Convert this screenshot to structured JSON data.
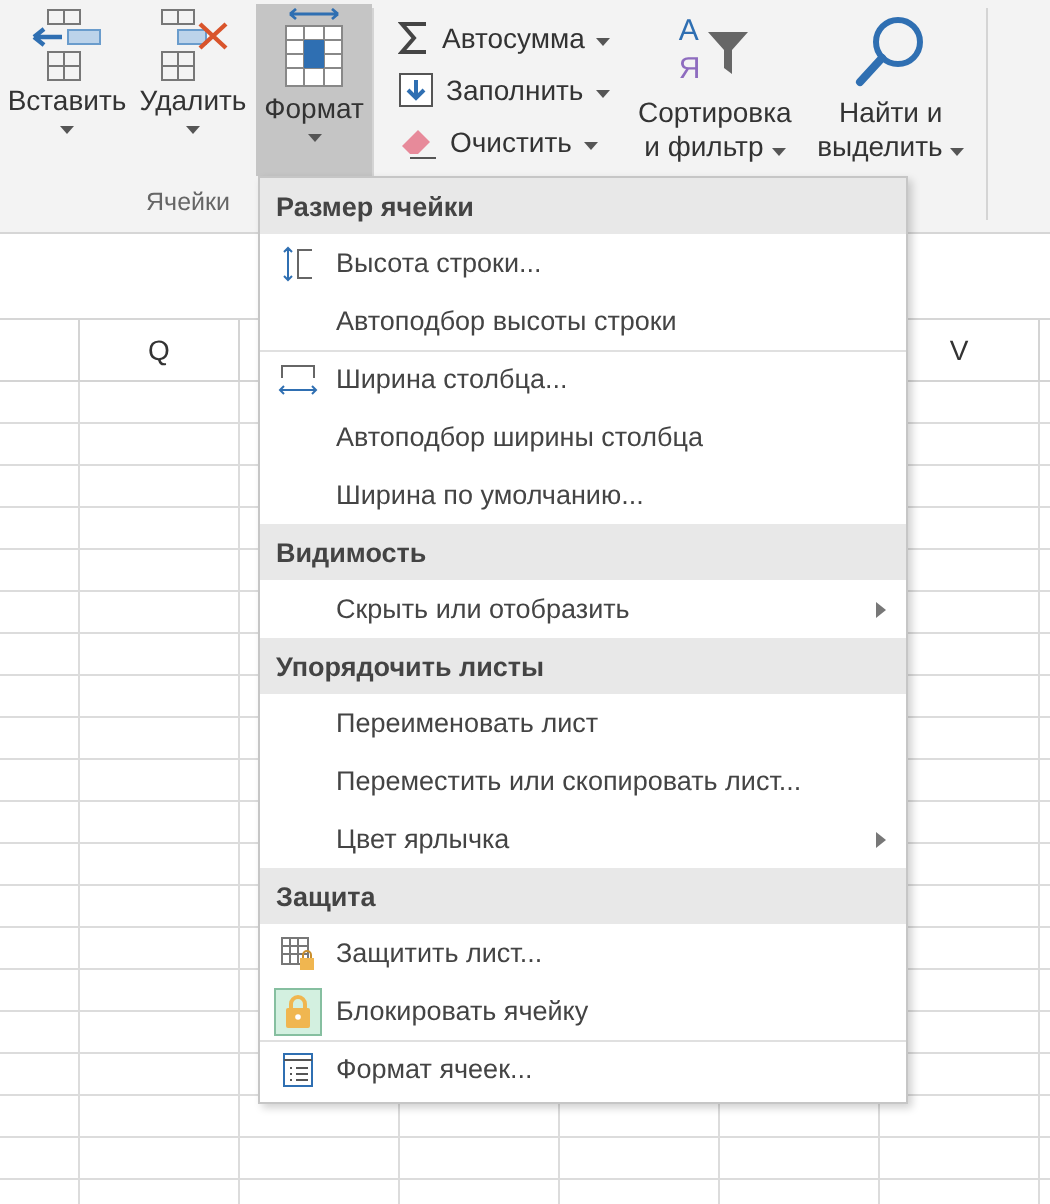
{
  "ribbon": {
    "cells_group": {
      "label": "Ячейки",
      "buttons": [
        {
          "label": "Вставить",
          "selected": false
        },
        {
          "label": "Удалить",
          "selected": false
        },
        {
          "label": "Формат",
          "selected": true
        }
      ]
    },
    "editing": {
      "small_buttons": [
        {
          "label": "Автосумма"
        },
        {
          "label": "Заполнить"
        },
        {
          "label": "Очистить"
        }
      ],
      "big_buttons": [
        {
          "icon_letters": [
            "А",
            "Я"
          ],
          "lines": [
            "Сортировка",
            "и фильтр"
          ]
        },
        {
          "lines": [
            "Найти и",
            "выделить"
          ]
        }
      ]
    }
  },
  "sheet": {
    "column_headers": [
      "Q",
      "V"
    ]
  },
  "menu": {
    "sections": [
      {
        "title": "Размер ячейки",
        "items": [
          {
            "label": "Высота строки...",
            "checked": false,
            "submenu": false,
            "separator_before": false
          },
          {
            "label": "Автоподбор высоты строки",
            "checked": false,
            "submenu": false,
            "separator_before": false
          },
          {
            "label": "Ширина столбца...",
            "checked": false,
            "submenu": false,
            "separator_before": true
          },
          {
            "label": "Автоподбор ширины столбца",
            "checked": false,
            "submenu": false,
            "separator_before": false
          },
          {
            "label": "Ширина по умолчанию...",
            "checked": false,
            "submenu": false,
            "separator_before": false
          }
        ]
      },
      {
        "title": "Видимость",
        "items": [
          {
            "label": "Скрыть или отобразить",
            "checked": false,
            "submenu": true,
            "separator_before": false
          }
        ]
      },
      {
        "title": "Упорядочить листы",
        "items": [
          {
            "label": "Переименовать лист",
            "checked": false,
            "submenu": false,
            "separator_before": false
          },
          {
            "label": "Переместить или скопировать лист...",
            "checked": false,
            "submenu": false,
            "separator_before": false
          },
          {
            "label": "Цвет ярлычка",
            "checked": false,
            "submenu": true,
            "separator_before": false
          }
        ]
      },
      {
        "title": "Защита",
        "items": [
          {
            "label": "Защитить лист...",
            "checked": false,
            "submenu": false,
            "separator_before": false
          },
          {
            "label": "Блокировать ячейку",
            "checked": true,
            "submenu": false,
            "separator_before": false
          },
          {
            "label": "Формат ячеек...",
            "checked": false,
            "submenu": false,
            "separator_before": true
          }
        ]
      }
    ]
  }
}
